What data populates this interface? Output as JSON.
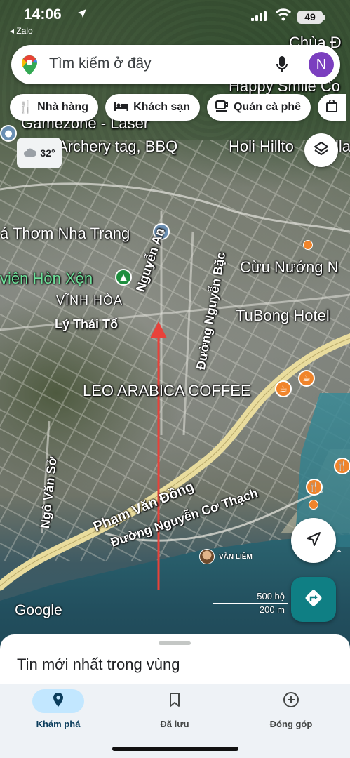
{
  "status_bar": {
    "time": "14:06",
    "back_app": "◂ Zalo",
    "battery": "49"
  },
  "search": {
    "placeholder": "Tìm kiếm ở đây",
    "avatar_letter": "N",
    "avatar_color": "#7b3fbf"
  },
  "chips": [
    {
      "label": "Nhà hàng",
      "icon": "restaurant-icon"
    },
    {
      "label": "Khách sạn",
      "icon": "hotel-icon"
    },
    {
      "label": "Quán cà phê",
      "icon": "coffee-icon"
    }
  ],
  "weather": {
    "temp": "32°",
    "icon": "cloud-icon"
  },
  "map": {
    "labels": {
      "chua": "Chùa Đ",
      "happy_smile": "Happy Smile Co",
      "gamezone": "Gamezone - Laser",
      "archery": "Archery tag, BBQ",
      "holi": "Holi Hillto",
      "holi_tail": "lla",
      "thom": "á Thơm Nha Trang",
      "hon_xen": "viên Hòn Xện",
      "vinh_hoa": "VĨNH HÒA",
      "ly_thai_to": "Lý Thái Tổ",
      "nguyen_an": "Nguyễn An",
      "nguyen_bac": "Đường Nguyễn Bặc",
      "cuu_nuong": "Cừu Nướng N",
      "tubong": "TuBong Hotel",
      "leo_arabica": "LEO ARABICA COFFEE",
      "ngo_van_so": "Ngô Văn Sở",
      "pham_van_dong": "Phạm Văn Đồng",
      "nguyen_co_thach": "Đường Nguyễn Cơ Thạch",
      "van_liem": "VĂN LIÊM"
    },
    "scale": {
      "top": "500 bộ",
      "bottom": "200 m"
    },
    "attribution": "Google",
    "colors": {
      "orange_pin": "#f0842b",
      "green_pin": "#1e8e3e",
      "annotation_arrow": "#e8423a"
    }
  },
  "sheet": {
    "title": "Tin mới nhất trong vùng"
  },
  "nav": [
    {
      "label": "Khám phá",
      "icon": "explore-pin-icon",
      "active": true
    },
    {
      "label": "Đã lưu",
      "icon": "bookmark-icon",
      "active": false
    },
    {
      "label": "Đóng góp",
      "icon": "add-circle-icon",
      "active": false
    }
  ]
}
